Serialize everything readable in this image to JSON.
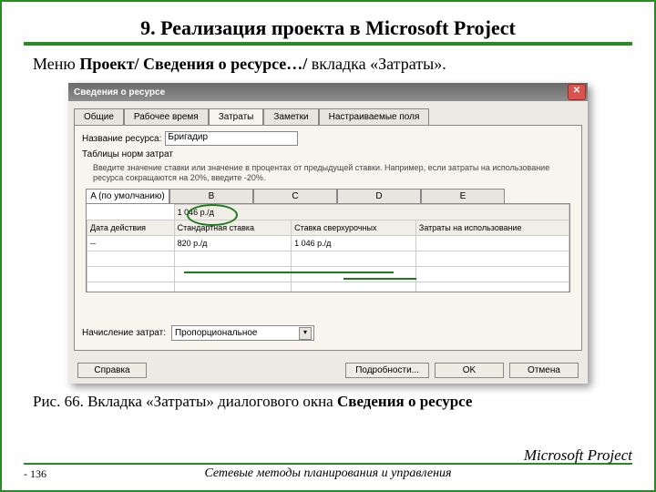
{
  "slide": {
    "title": "9. Реализация проекта в Microsoft Project",
    "subtitle_prefix": "Меню ",
    "subtitle_bold": "Проект/ Сведения о ресурсе…/",
    "subtitle_suffix": " вкладка «Затраты».",
    "caption_prefix": "Рис. 66. Вкладка «Затраты» диалогового окна ",
    "caption_bold": "Сведения о ресурсе"
  },
  "dialog": {
    "title": "Сведения о ресурсе",
    "close_glyph": "✕",
    "tabs": [
      "Общие",
      "Рабочее время",
      "Затраты",
      "Заметки",
      "Настраиваемые поля"
    ],
    "name_label": "Название ресурса:",
    "name_value": "Бригадир",
    "table_label": "Таблицы норм затрат",
    "hint": "Введите значение ставки или значение в процентах от предыдущей ставки. Например, если затраты на использование ресурса сокращаются на 20%, введите -20%.",
    "rate_tabs": [
      "A (по умолчанию)",
      "B",
      "C",
      "D",
      "E"
    ],
    "rate_headers": [
      "Дата действия",
      "Стандартная ставка",
      "Ставка сверхурочных",
      "Затраты на использование"
    ],
    "pre_header_left": "1 046 р./д",
    "rate_rows": [
      [
        "--",
        "820 р./д",
        "1 046 р./д",
        ""
      ],
      [
        "",
        "",
        "",
        ""
      ],
      [
        "",
        "",
        "",
        ""
      ],
      [
        "",
        "",
        "",
        ""
      ]
    ],
    "accrue_label": "Начисление затрат:",
    "accrue_value": "Пропорциональное",
    "buttons": {
      "help": "Справка",
      "details": "Подробности...",
      "ok": "OK",
      "cancel": "Отмена"
    }
  },
  "footer": {
    "page": "- 136",
    "center": "Сетевые методы планирования и управления",
    "brand": "Microsoft Project"
  }
}
